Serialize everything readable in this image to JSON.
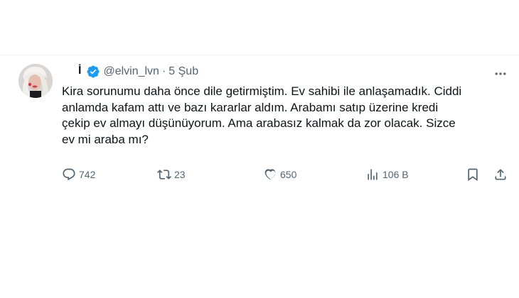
{
  "tweet": {
    "display_name": "İ",
    "handle": "@elvin_lvn",
    "separator": "·",
    "date": "5 Şub",
    "text": "Kira sorunumu daha önce dile getirmiştim. Ev sahibi ile anlaşamadık. Ciddi\nanlamda kafam attı ve bazı kararlar aldım. Arabamı satıp üzerine kredi\nçekip ev almayı düşünüyorum. Ama arabasız kalmak da zor olacak. Sizce\nev mi araba mı?",
    "stats": {
      "replies": "742",
      "retweets": "23",
      "likes": "650",
      "views": "106 B"
    }
  },
  "icons": {
    "verified": "verified-badge-icon",
    "more": "more-dots-icon",
    "reply": "reply-bubble-icon",
    "retweet": "retweet-icon",
    "like": "heart-icon",
    "views": "views-bar-chart-icon",
    "bookmark": "bookmark-icon",
    "share": "share-upload-icon"
  },
  "colors": {
    "text": "#0f1419",
    "secondary": "#536471",
    "verified": "#1d9bf0",
    "divider": "#eff3f4"
  }
}
